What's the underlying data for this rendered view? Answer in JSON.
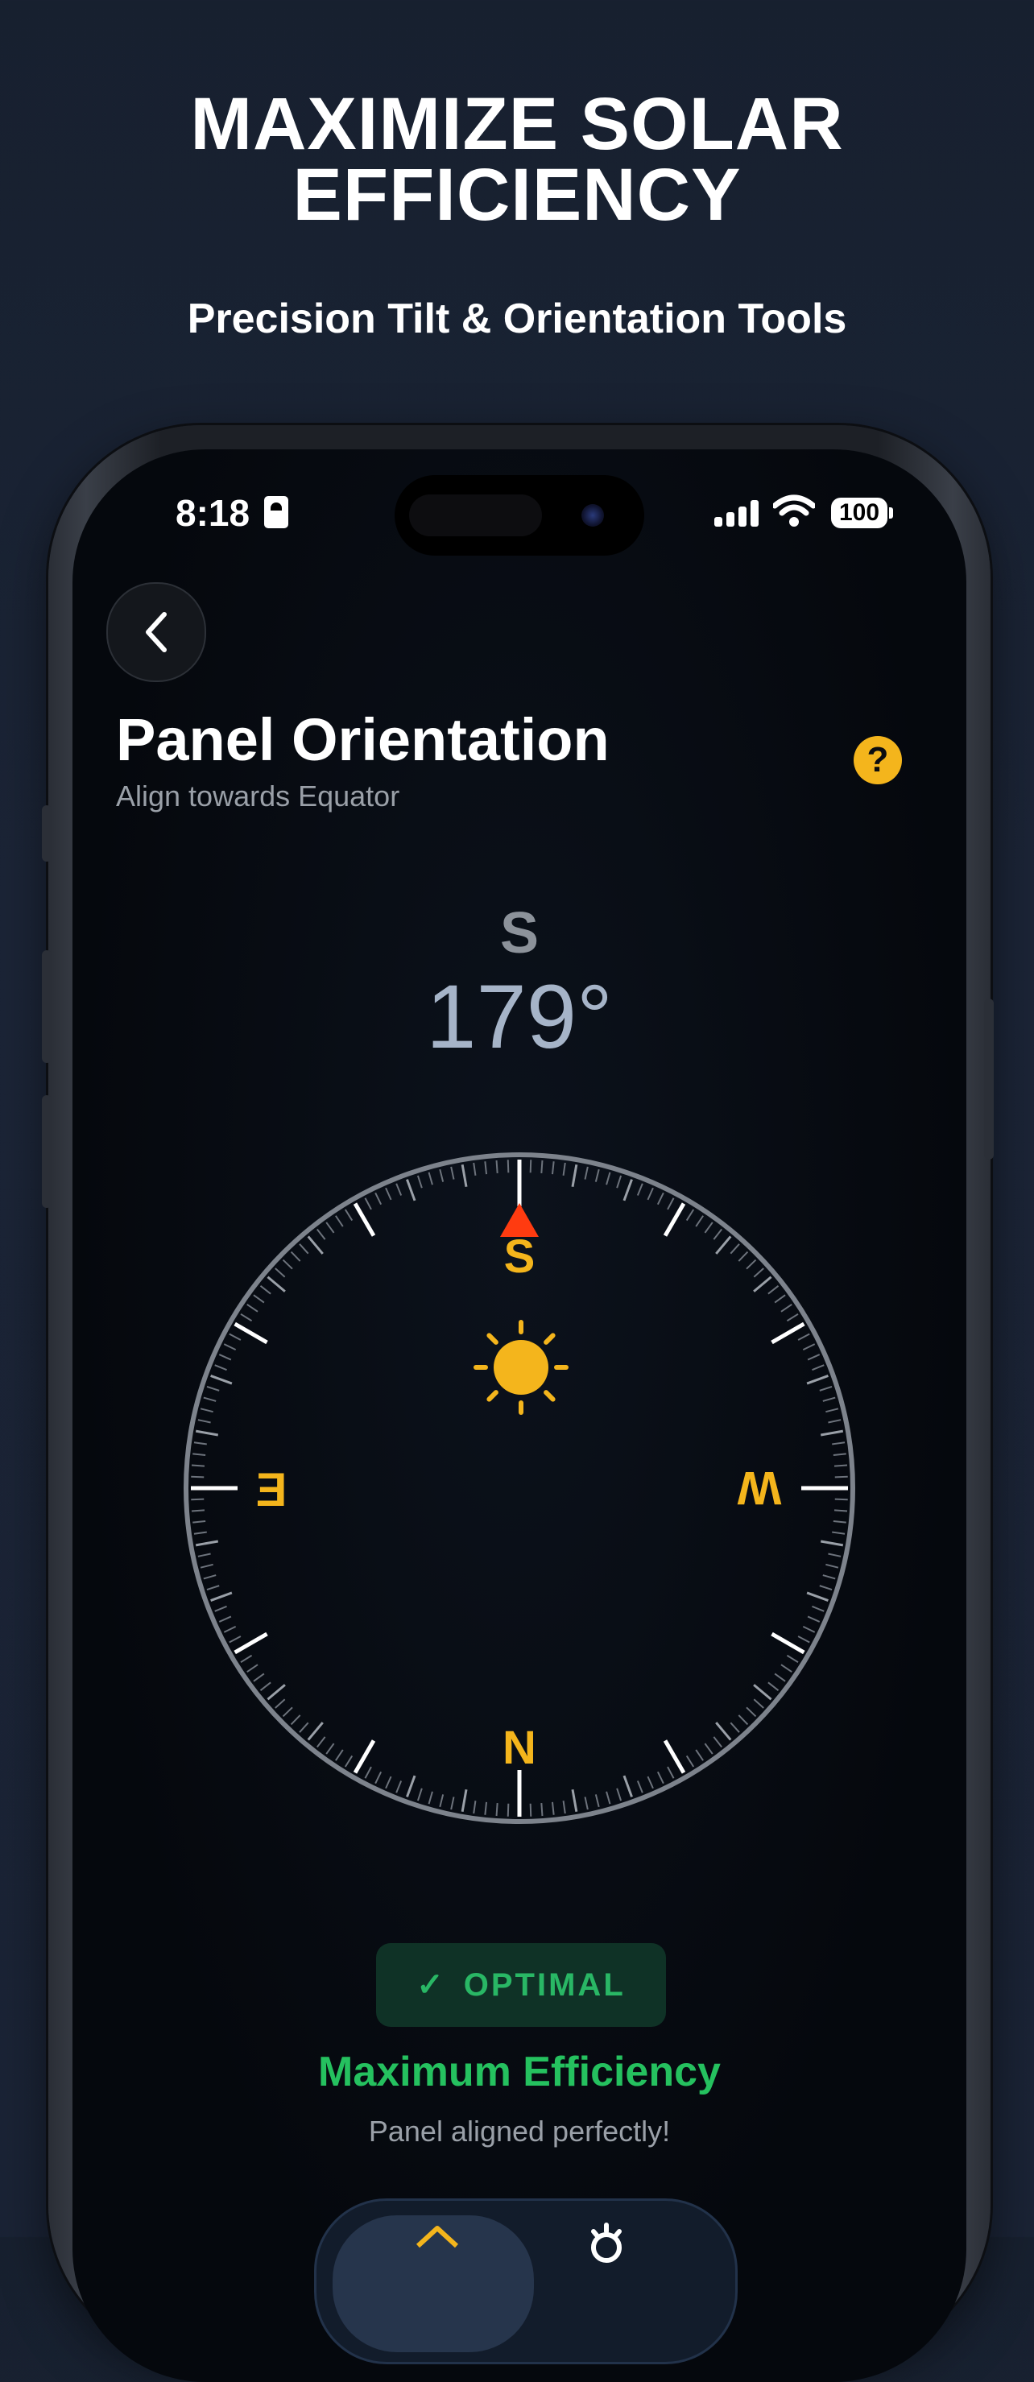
{
  "promo": {
    "headline_line1": "MAXIMIZE SOLAR",
    "headline_line2": "EFFICIENCY",
    "subheadline": "Precision Tilt & Orientation Tools"
  },
  "status_bar": {
    "time": "8:18",
    "battery": "100"
  },
  "header": {
    "back_icon": "chevron-left-icon",
    "title": "Panel Orientation",
    "subtitle": "Align towards Equator",
    "help_symbol": "?"
  },
  "heading": {
    "direction": "S",
    "degrees": "179°"
  },
  "compass": {
    "heading_degrees": 179,
    "labels": {
      "top": "S",
      "left": "E",
      "right": "W",
      "bottom": "N"
    },
    "accent_color": "#f4b51c",
    "pointer_color": "#ff3b10"
  },
  "status": {
    "badge_check": "✓",
    "badge": "OPTIMAL",
    "title": "Maximum Efficiency",
    "description": "Panel aligned perfectly!",
    "color": "#25c15f"
  },
  "tabbar": {
    "active_icon": "home-icon",
    "second_icon": "settings-icon"
  }
}
